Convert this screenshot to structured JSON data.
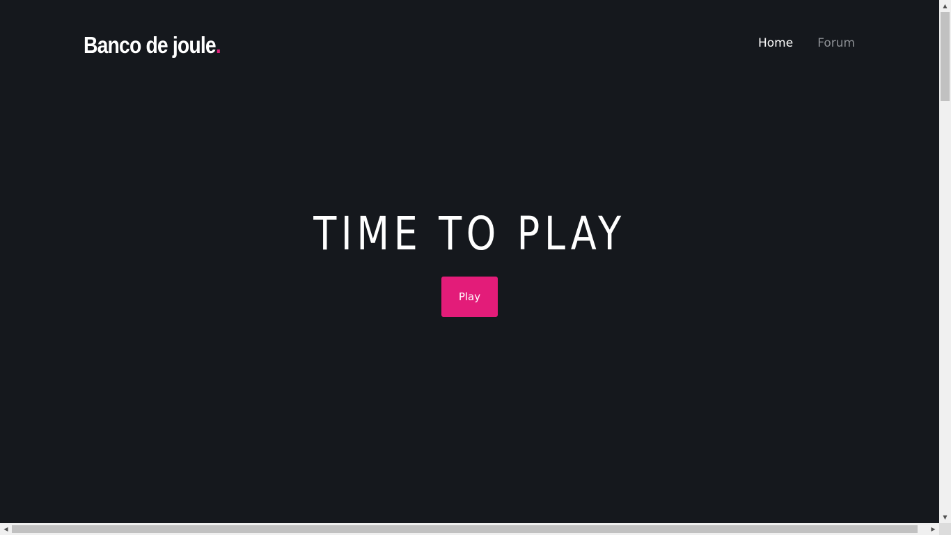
{
  "header": {
    "brand_name": "Banco de joule",
    "brand_dot": ".",
    "nav": [
      {
        "label": "Home",
        "active": true
      },
      {
        "label": "Forum",
        "active": false
      }
    ]
  },
  "hero": {
    "title": "TIME TO PLAY",
    "button_label": "Play"
  },
  "colors": {
    "background": "#15181d",
    "accent": "#e31c79",
    "nav_inactive": "#8e9196"
  },
  "scrollbars": {
    "up_icon": "scroll-up-arrow-icon",
    "down_icon": "scroll-down-arrow-icon",
    "left_icon": "scroll-left-arrow-icon",
    "right_icon": "scroll-right-arrow-icon"
  }
}
